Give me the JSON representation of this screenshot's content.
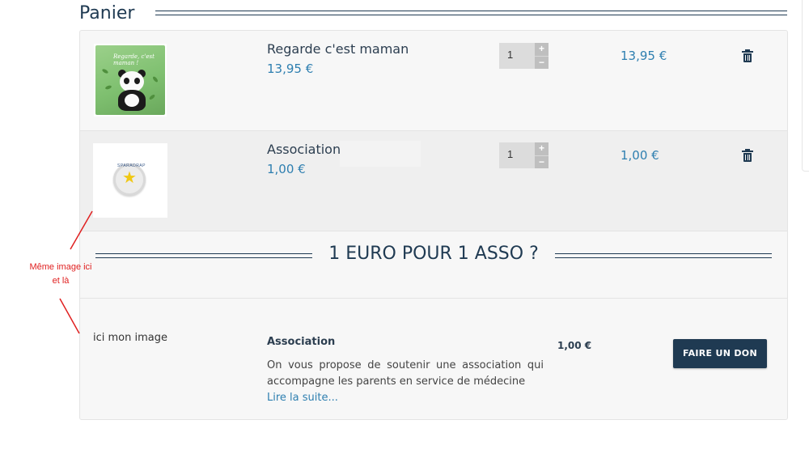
{
  "page": {
    "title": "Panier"
  },
  "cart": {
    "items": [
      {
        "name": "Regarde c'est maman",
        "unit_price": "13,95 €",
        "quantity": "1",
        "total": "13,95 €",
        "image": "book-cover-panda",
        "cover_text": "Regarde, c'est maman !"
      },
      {
        "name": "Association",
        "unit_price": "1,00 €",
        "quantity": "1",
        "total": "1,00 €",
        "image": "association-badge",
        "badge_text": "SPARADRAP"
      }
    ],
    "qty_plus_label": "+",
    "qty_minus_label": "−"
  },
  "donation": {
    "heading": "1 EURO POUR 1 ASSO ?",
    "image_placeholder": "ici mon image",
    "name": "Association",
    "description": "On vous propose de soutenir une association qui accompagne les parents en service de médecine",
    "read_more": "Lire la suite...",
    "price": "1,00 €",
    "button_label": "FAIRE UN DON"
  },
  "annotation": {
    "line1": "Même image ici",
    "line2": "et là",
    "color": "#e02020"
  },
  "colors": {
    "primary": "#1f3a52",
    "price": "#2e7fb0",
    "panel": "#f7f7f7"
  },
  "icons": {
    "delete": "trash-icon",
    "increment": "plus-icon",
    "decrement": "minus-icon"
  }
}
